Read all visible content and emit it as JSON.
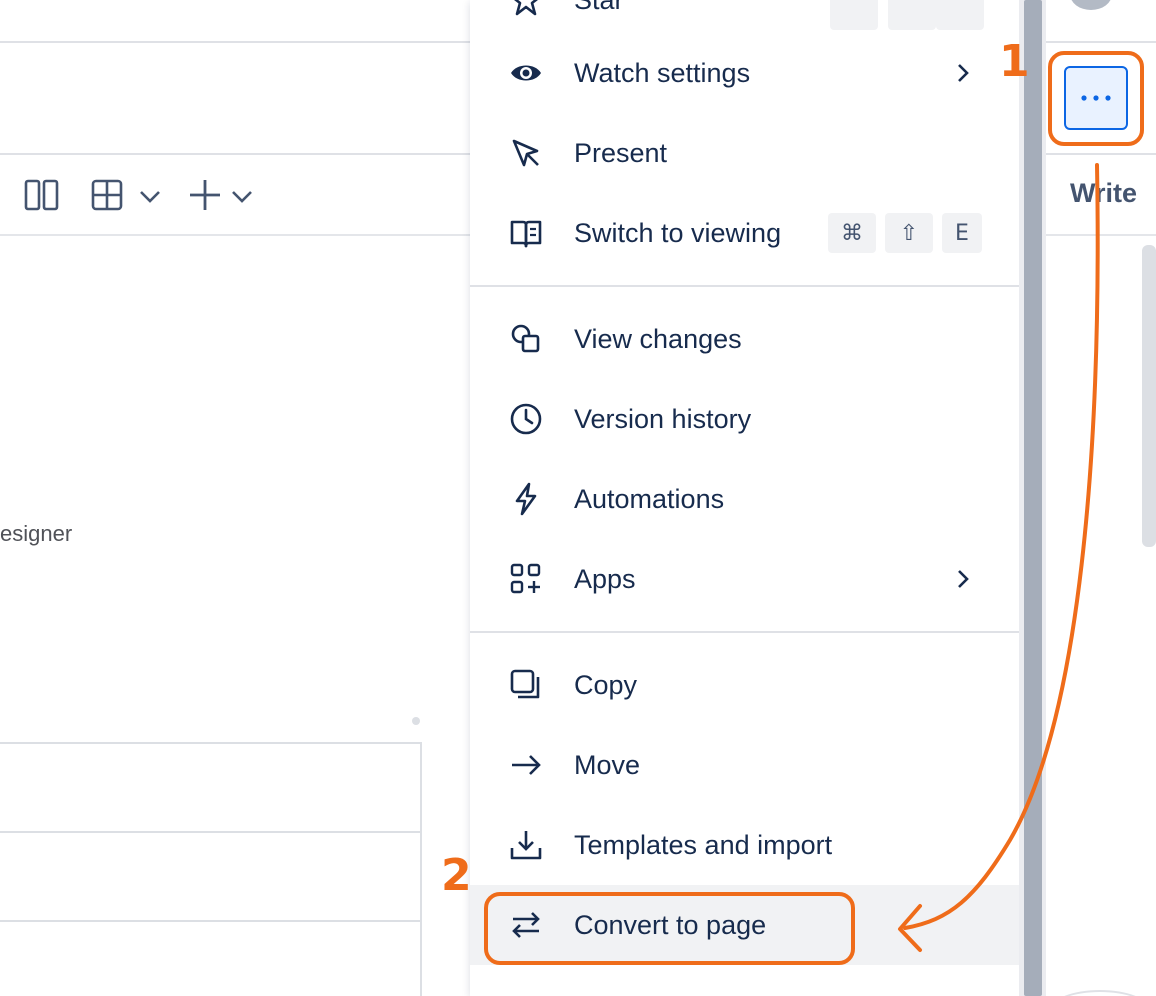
{
  "background": {
    "partial_text": "esigner",
    "write_label": "Write"
  },
  "menu": {
    "items": [
      {
        "id": "star",
        "label": "Star",
        "icon": "star-icon"
      },
      {
        "id": "watch-settings",
        "label": "Watch settings",
        "icon": "eye-icon",
        "submenu": true
      },
      {
        "id": "present",
        "label": "Present",
        "icon": "pointer-icon"
      },
      {
        "id": "switch-to-viewing",
        "label": "Switch to viewing",
        "icon": "book-icon",
        "shortcut": [
          "⌘",
          "⇧",
          "E"
        ]
      },
      {
        "id": "view-changes",
        "label": "View changes",
        "icon": "compare-icon"
      },
      {
        "id": "version-history",
        "label": "Version history",
        "icon": "clock-icon"
      },
      {
        "id": "automations",
        "label": "Automations",
        "icon": "lightning-icon"
      },
      {
        "id": "apps",
        "label": "Apps",
        "icon": "apps-icon",
        "submenu": true
      },
      {
        "id": "copy",
        "label": "Copy",
        "icon": "copy-icon"
      },
      {
        "id": "move",
        "label": "Move",
        "icon": "arrow-right-icon"
      },
      {
        "id": "templates-and-import",
        "label": "Templates and import",
        "icon": "download-icon"
      },
      {
        "id": "convert-to-page",
        "label": "Convert to page",
        "icon": "swap-icon",
        "highlighted": true
      }
    ]
  },
  "annotations": {
    "step1": "1",
    "step2": "2",
    "color": "#ef6c1a"
  },
  "colors": {
    "accent": "#0c66e4",
    "text": "#172b4d",
    "annotation": "#ef6c1a"
  }
}
